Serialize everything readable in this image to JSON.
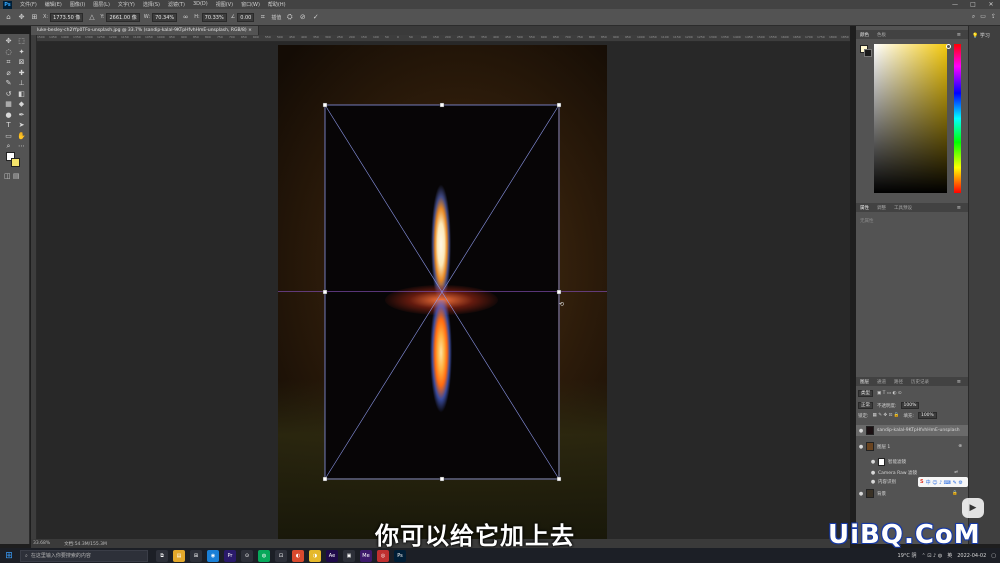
{
  "menubar": {
    "logo": "Ps",
    "items": [
      "文件(F)",
      "编辑(E)",
      "图像(I)",
      "图层(L)",
      "文字(Y)",
      "选择(S)",
      "滤镜(T)",
      "3D(D)",
      "视图(V)",
      "窗口(W)",
      "帮助(H)"
    ],
    "minimize": "—",
    "maximize": "□",
    "close": "✕"
  },
  "options": {
    "x_label": "X:",
    "x_value": "1773.50 像",
    "y_label": "Y:",
    "y_value": "2661.00 像",
    "w_label": "W:",
    "w_value": "70.34%",
    "h_label": "H:",
    "h_value": "70.33%",
    "angle_label": "∠",
    "angle_value": "0.00",
    "interp": "插值",
    "cancel_icon": "cancel-icon",
    "commit_icon": "commit-icon"
  },
  "tabs": [
    {
      "label": "luke-besley-ch2Yfp0TFo-unsplash.jpg @ 33.7% (sandip-kalal-9KTpHfvhHmE-unsplash, RGB/8)",
      "close": "×"
    }
  ],
  "ruler": {
    "ticks": [
      "1500",
      "1450",
      "1400",
      "1350",
      "1300",
      "1250",
      "1200",
      "1150",
      "1100",
      "1050",
      "1000",
      "950",
      "900",
      "850",
      "800",
      "750",
      "700",
      "650",
      "600",
      "550",
      "500",
      "450",
      "400",
      "350",
      "300",
      "250",
      "200",
      "150",
      "100",
      "50",
      "0",
      "50",
      "100",
      "150",
      "200",
      "250",
      "300",
      "350",
      "400",
      "450",
      "500",
      "550",
      "600",
      "650",
      "700",
      "750",
      "800",
      "850",
      "900",
      "950",
      "1000",
      "1050",
      "1100",
      "1150",
      "1200",
      "1250",
      "1300",
      "1350",
      "1400",
      "1450",
      "1500",
      "1550",
      "1600",
      "1650",
      "1700",
      "1750",
      "1800",
      "1850",
      "1900",
      "1950",
      "2000",
      "2050"
    ]
  },
  "status": {
    "zoom": "33.68%",
    "doc": "文档:54.3M/155.3M"
  },
  "panels": {
    "color_tabs": [
      "颜色",
      "色板"
    ],
    "props_tabs": [
      "属性",
      "调整",
      "工具预设"
    ],
    "props_empty": "无属性",
    "layers_tabs": [
      "图层",
      "通道",
      "路径",
      "历史记录"
    ],
    "layer_kind": "类型",
    "blend_mode": "正常",
    "opacity_label": "不透明度:",
    "opacity_value": "100%",
    "lock_label": "锁定:",
    "fill_label": "填充:",
    "fill_value": "100%",
    "layers": [
      {
        "name": "sandip-kalal-9KTpHfvhHmE-unsplash",
        "thumb": "#1b1012",
        "eye": "●"
      },
      {
        "name": "图层 1",
        "thumb": "#6a4420",
        "eye": "●"
      },
      {
        "name": "智能滤镜",
        "thumb": "#ffffff",
        "eye": "●"
      },
      {
        "name": "Camera Raw 滤镜",
        "thumb": "",
        "eye": "●"
      },
      {
        "name": "内容识别",
        "thumb": "",
        "eye": "●"
      },
      {
        "name": "背景",
        "thumb": "#3a3226",
        "eye": "●"
      }
    ],
    "learn": "学习"
  },
  "taskbar": {
    "search_placeholder": "在这里输入你要搜索的内容",
    "apps": [
      {
        "label": "⧉",
        "color": "#2d3039"
      },
      {
        "label": "▤",
        "color": "#e3a82b"
      },
      {
        "label": "⊞",
        "color": "#2d3039"
      },
      {
        "label": "◉",
        "color": "#1a7fd6"
      },
      {
        "label": "Pr",
        "color": "#2a1a6b"
      },
      {
        "label": "⊙",
        "color": "#2d3039"
      },
      {
        "label": "◍",
        "color": "#07a85a"
      },
      {
        "label": "⊡",
        "color": "#2d3039"
      },
      {
        "label": "◐",
        "color": "#d84a2e"
      },
      {
        "label": "◑",
        "color": "#e5b82a"
      },
      {
        "label": "Ae",
        "color": "#1f0a4a"
      },
      {
        "label": "▣",
        "color": "#2d3039"
      },
      {
        "label": "Me",
        "color": "#3d1a6b"
      },
      {
        "label": "◎",
        "color": "#c03030"
      },
      {
        "label": "Ps",
        "color": "#001e36"
      }
    ],
    "weather": "19°C 阴",
    "ime": "英",
    "date": "2022-04-02"
  },
  "overlay": {
    "subtitle": "你可以给它加上去",
    "watermark": "UiBQ.CoM",
    "ime_logo": "S",
    "ime_items": "中 ☺ ♪ ⌨ ✎ ⚙"
  }
}
